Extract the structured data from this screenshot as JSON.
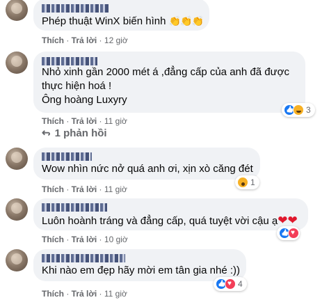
{
  "comments": [
    {
      "text_lines": [
        "Phép thuật WinX biến hình"
      ],
      "emoji": "👏👏👏",
      "like": "Thích",
      "reply": "Trả lời",
      "time": "12 giờ"
    },
    {
      "text_lines": [
        "Nhỏ xinh gần 2000 mét á ,đẳng cấp của anh đã được",
        "thực hiện hoá !",
        "Ông hoàng Luxyry"
      ],
      "like": "Thích",
      "reply": "Trả lời",
      "time": "11 giờ",
      "reaction_count": "3",
      "reactions": [
        "like-icon",
        "haha-icon"
      ],
      "replies_label": "1 phản hồi"
    },
    {
      "text_lines": [
        "Wow nhìn nức nở quá anh ơi, xịn xò căng đét"
      ],
      "like": "Thích",
      "reply": "Trả lời",
      "time": "11 giờ",
      "reaction_count": "1",
      "reactions": [
        "wow-icon"
      ]
    },
    {
      "text_lines": [
        "Luôn hoành tráng và đẳng cấp, quá tuyệt vời cậu ạ"
      ],
      "emoji": "❤❤",
      "like": "Thích",
      "reply": "Trả lời",
      "time": "10 giờ",
      "reactions": [
        "like-icon",
        "heart-icon"
      ]
    },
    {
      "text_lines": [
        "Khi nào em đẹp hãy mời em tân gia nhé :))"
      ],
      "like": "Thích",
      "reply": "Trả lời",
      "time": "11 giờ",
      "reaction_count": "4",
      "reactions": [
        "like-icon",
        "heart-icon"
      ]
    }
  ],
  "colors": {
    "bubble": "#f0f2f5",
    "meta_text": "#65676b",
    "like_blue": "#1877f2",
    "heart_red": "#f33e58"
  }
}
